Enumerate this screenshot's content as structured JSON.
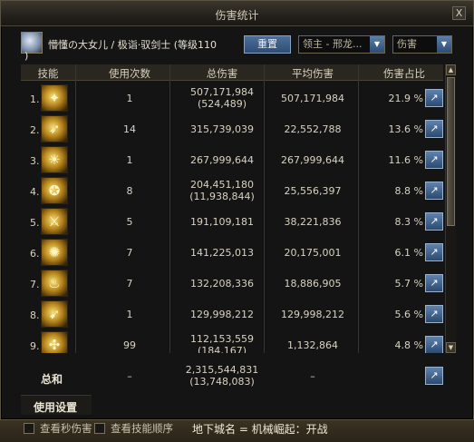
{
  "window": {
    "title": "伤害统计",
    "close_label": "X"
  },
  "character": {
    "name": "懵懂の大女儿 / 极诣·驭剑士 (等级110",
    "name_cont": ")",
    "reset_label": "重置"
  },
  "selects": {
    "target": "领主 - 邢龙...",
    "type": "伤害"
  },
  "table": {
    "headers": [
      "技能",
      "使用次数",
      "总伤害",
      "平均伤害",
      "伤害占比"
    ],
    "rows": [
      {
        "idx": "1.",
        "icon": "skill-1-icon",
        "uses": "1",
        "total": "507,171,984",
        "total_sub": "(524,489)",
        "avg": "507,171,984",
        "pct": "21.9 %"
      },
      {
        "idx": "2.",
        "icon": "skill-2-icon",
        "uses": "14",
        "total": "315,739,039",
        "total_sub": "",
        "avg": "22,552,788",
        "pct": "13.6 %"
      },
      {
        "idx": "3.",
        "icon": "skill-3-icon",
        "uses": "1",
        "total": "267,999,644",
        "total_sub": "",
        "avg": "267,999,644",
        "pct": "11.6 %"
      },
      {
        "idx": "4.",
        "icon": "skill-4-icon",
        "uses": "8",
        "total": "204,451,180",
        "total_sub": "(11,938,844)",
        "avg": "25,556,397",
        "pct": "8.8 %"
      },
      {
        "idx": "5.",
        "icon": "skill-5-icon",
        "uses": "5",
        "total": "191,109,181",
        "total_sub": "",
        "avg": "38,221,836",
        "pct": "8.3 %"
      },
      {
        "idx": "6.",
        "icon": "skill-6-icon",
        "uses": "7",
        "total": "141,225,013",
        "total_sub": "",
        "avg": "20,175,001",
        "pct": "6.1 %"
      },
      {
        "idx": "7.",
        "icon": "skill-7-icon",
        "uses": "7",
        "total": "132,208,336",
        "total_sub": "",
        "avg": "18,886,905",
        "pct": "5.7 %"
      },
      {
        "idx": "8.",
        "icon": "skill-8-icon",
        "uses": "1",
        "total": "129,998,212",
        "total_sub": "",
        "avg": "129,998,212",
        "pct": "5.6 %"
      },
      {
        "idx": "9.",
        "icon": "skill-9-icon",
        "uses": "99",
        "total": "112,153,559",
        "total_sub": "(184,167)",
        "avg": "1,132,864",
        "pct": "4.8 %"
      }
    ]
  },
  "total": {
    "label": "总和",
    "uses": "–",
    "total": "2,315,544,831",
    "total_sub": "(13,748,083)",
    "avg": "–"
  },
  "settings_label": "使用设置",
  "footer": {
    "dps_label": "查看秒伤害",
    "order_label": "查看技能顺序",
    "dungeon": "地下城名 = 机械崛起：开战"
  },
  "colors": {
    "accent": "#2d4d74",
    "text": "#d8d2c2",
    "icon_gold": "#f7e07a"
  }
}
